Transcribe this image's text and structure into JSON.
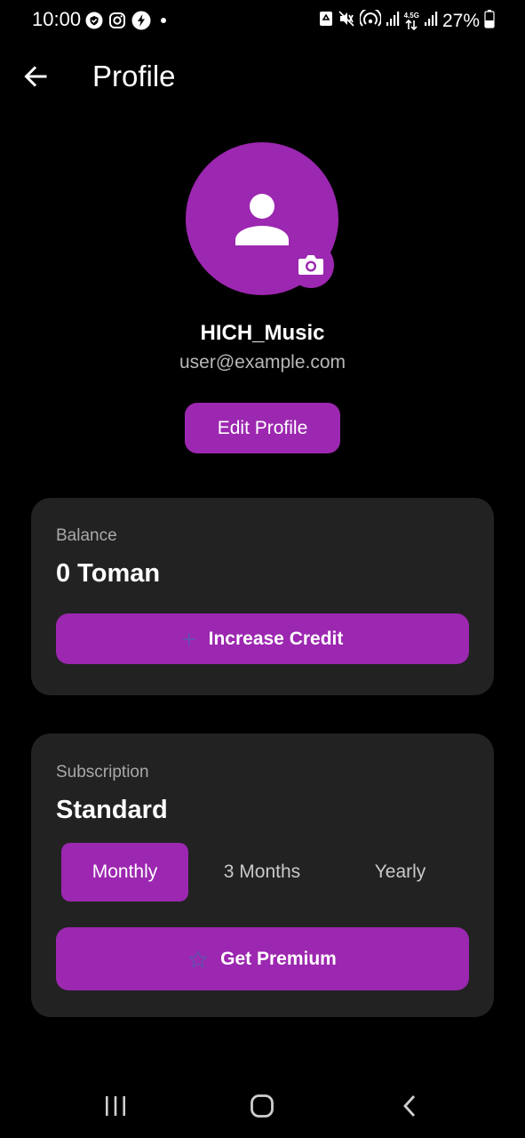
{
  "status_bar": {
    "time": "10:00",
    "battery": "27%",
    "network_label": "4.5G",
    "left_icons": [
      "shield-check-icon",
      "instagram-icon",
      "flash-app-icon",
      "dot-icon"
    ],
    "right_icons": [
      "recycle-icon",
      "mute-icon",
      "hotspot-icon",
      "signal-icon",
      "data-arrows-icon",
      "signal-icon",
      "battery-icon"
    ]
  },
  "app_bar": {
    "title": "Profile",
    "back_icon": "arrow-left-icon"
  },
  "profile": {
    "username": "HICH_Music",
    "email": "user@example.com",
    "edit_label": "Edit Profile",
    "avatar_icon": "person-icon",
    "camera_icon": "camera-icon"
  },
  "balance": {
    "label": "Balance",
    "value": "0 Toman",
    "button_label": "Increase Credit",
    "button_icon": "plus-icon"
  },
  "subscription": {
    "label": "Subscription",
    "plan": "Standard",
    "periods": [
      "Monthly",
      "3 Months",
      "Yearly"
    ],
    "selected_period": "Monthly",
    "button_label": "Get Premium",
    "button_icon": "star-icon"
  },
  "nav_bar": {
    "icons": [
      "recents-icon",
      "home-icon",
      "back-icon"
    ]
  },
  "colors": {
    "accent": "#9c27b0",
    "background": "#000000",
    "card": "#222222",
    "muted_text": "#a9a9a9"
  }
}
